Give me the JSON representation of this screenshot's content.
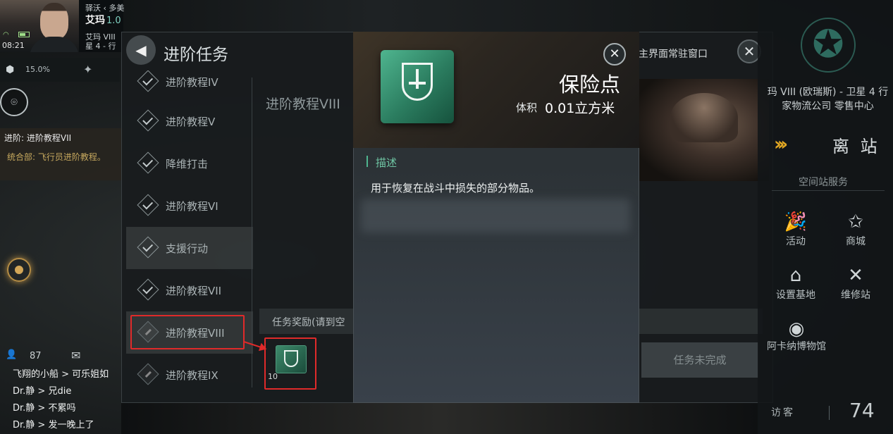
{
  "hud": {
    "time": "08:21",
    "region": "驿沃  ‹ 多美",
    "pilot_name": "艾玛",
    "security": "1.0",
    "location_line1": "艾玛 VIII",
    "location_line2": "星 4 - 行",
    "cargo_percent": "15.0%",
    "mission_title": "进阶: 进阶教程VII",
    "mission_sub": "统合部: 飞行员进阶教程。"
  },
  "chat": {
    "online_count": "87",
    "lines": [
      "飞翔的小船 > 可乐姐如",
      "Dr.静 > 兄die",
      "Dr.静 > 不累吗",
      "Dr.静 > 发一晚上了"
    ]
  },
  "panel": {
    "title": "进阶任务",
    "hint": "主界面常驻窗口",
    "close_glyph": "✕",
    "back_glyph": "◀"
  },
  "mission_list": [
    {
      "label": "进阶教程IV",
      "state": "done"
    },
    {
      "label": "进阶教程V",
      "state": "done"
    },
    {
      "label": "降维打击",
      "state": "done"
    },
    {
      "label": "进阶教程VI",
      "state": "done"
    },
    {
      "label": "支援行动",
      "state": "active"
    },
    {
      "label": "进阶教程VII",
      "state": "current"
    },
    {
      "label": "进阶教程VIII",
      "state": "locked"
    },
    {
      "label": "进阶教程IX",
      "state": "locked"
    }
  ],
  "detail": {
    "title": "进阶教程VIII",
    "reward_label": "任务奖励(请到空",
    "reward_qty": "10",
    "incomplete_button": "任务未完成"
  },
  "item_modal": {
    "name": "保险点",
    "volume_label": "体积",
    "volume_value": "0.01立方米",
    "desc_heading": "描述",
    "desc_text": "用于恢复在战斗中损失的部分物品。",
    "close_glyph": "✕",
    "accent_color": "#4fb58f"
  },
  "station": {
    "name": "玛 VIII (欧瑞斯) - 卫星 4 行家物流公司 零售中心",
    "undock_label": "离 站",
    "services_title": "空间站服务",
    "services": [
      {
        "label": "活动",
        "icon": "party-popper-icon"
      },
      {
        "label": "商城",
        "icon": "store-star-icon"
      },
      {
        "label": "设置基地",
        "icon": "base-icon"
      },
      {
        "label": "维修站",
        "icon": "repair-tools-icon"
      },
      {
        "label": "阿卡纳博物馆",
        "icon": "museum-icon"
      }
    ],
    "visitor_label": "访客",
    "visitor_count": "74"
  },
  "colors": {
    "annotation_red": "#e02a2a",
    "undock_arrow": "#e3a823",
    "emblem_teal": "#2e6b5f"
  }
}
